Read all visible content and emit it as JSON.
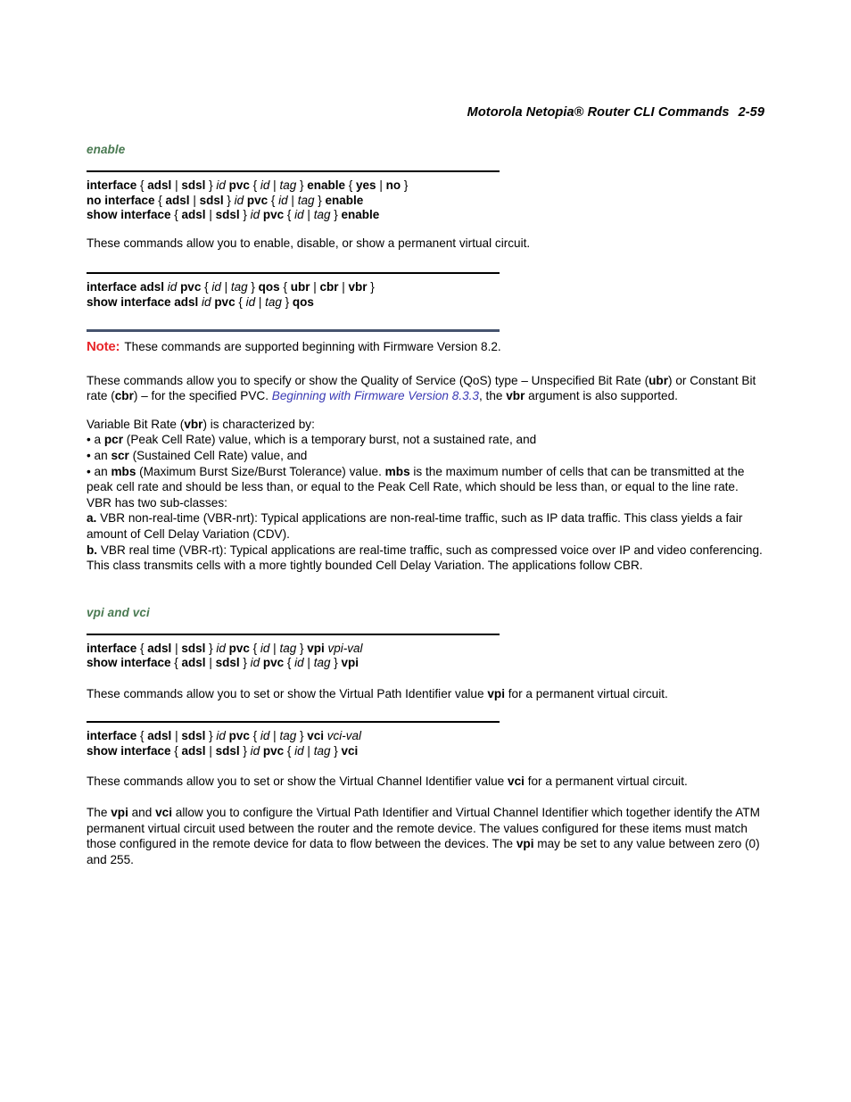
{
  "header": {
    "title": "Motorola Netopia® Router CLI Commands",
    "page_number": "2-59"
  },
  "colors": {
    "section_heading": "#4a7a52",
    "note_label": "#e8262a",
    "note_rule": "#46536e",
    "cross_reference": "#3a3ab4",
    "body_text": "#000000"
  },
  "sections": [
    {
      "id": "enable",
      "heading": "enable",
      "syntax_blocks": [
        {
          "lines": [
            [
              {
                "t": "interface ",
                "s": "b"
              },
              {
                "t": "{ ",
                "s": "n"
              },
              {
                "t": "adsl ",
                "s": "b"
              },
              {
                "t": "| ",
                "s": "n"
              },
              {
                "t": "sdsl ",
                "s": "b"
              },
              {
                "t": "} ",
                "s": "n"
              },
              {
                "t": "id ",
                "s": "i"
              },
              {
                "t": "pvc ",
                "s": "b"
              },
              {
                "t": "{ ",
                "s": "n"
              },
              {
                "t": "id ",
                "s": "i"
              },
              {
                "t": "| ",
                "s": "n"
              },
              {
                "t": "tag ",
                "s": "i"
              },
              {
                "t": "} ",
                "s": "n"
              },
              {
                "t": "enable ",
                "s": "b"
              },
              {
                "t": "{ ",
                "s": "n"
              },
              {
                "t": "yes ",
                "s": "b"
              },
              {
                "t": "| ",
                "s": "n"
              },
              {
                "t": "no ",
                "s": "b"
              },
              {
                "t": "}",
                "s": "n"
              }
            ],
            [
              {
                "t": "no interface ",
                "s": "b"
              },
              {
                "t": "{ ",
                "s": "n"
              },
              {
                "t": "adsl ",
                "s": "b"
              },
              {
                "t": "| ",
                "s": "n"
              },
              {
                "t": "sdsl ",
                "s": "b"
              },
              {
                "t": "} ",
                "s": "n"
              },
              {
                "t": "id ",
                "s": "i"
              },
              {
                "t": "pvc ",
                "s": "b"
              },
              {
                "t": "{ ",
                "s": "n"
              },
              {
                "t": "id ",
                "s": "i"
              },
              {
                "t": "| ",
                "s": "n"
              },
              {
                "t": "tag ",
                "s": "i"
              },
              {
                "t": "} ",
                "s": "n"
              },
              {
                "t": "enable",
                "s": "b"
              }
            ],
            [
              {
                "t": "show interface ",
                "s": "b"
              },
              {
                "t": "{ ",
                "s": "n"
              },
              {
                "t": "adsl ",
                "s": "b"
              },
              {
                "t": "| ",
                "s": "n"
              },
              {
                "t": "sdsl ",
                "s": "b"
              },
              {
                "t": "} ",
                "s": "n"
              },
              {
                "t": "id ",
                "s": "i"
              },
              {
                "t": "pvc ",
                "s": "b"
              },
              {
                "t": "{ ",
                "s": "n"
              },
              {
                "t": "id ",
                "s": "i"
              },
              {
                "t": "| ",
                "s": "n"
              },
              {
                "t": "tag ",
                "s": "i"
              },
              {
                "t": "} ",
                "s": "n"
              },
              {
                "t": "enable",
                "s": "b"
              }
            ]
          ]
        }
      ],
      "paragraph_1": "These commands allow you to enable, disable, or show a permanent virtual circuit."
    }
  ],
  "qos": {
    "syntax_lines": [
      [
        {
          "t": "interface adsl ",
          "s": "b"
        },
        {
          "t": "id ",
          "s": "i"
        },
        {
          "t": "pvc ",
          "s": "b"
        },
        {
          "t": "{ ",
          "s": "n"
        },
        {
          "t": "id ",
          "s": "i"
        },
        {
          "t": "| ",
          "s": "n"
        },
        {
          "t": "tag ",
          "s": "i"
        },
        {
          "t": "} ",
          "s": "n"
        },
        {
          "t": "qos ",
          "s": "b"
        },
        {
          "t": "{ ",
          "s": "n"
        },
        {
          "t": "ubr ",
          "s": "b"
        },
        {
          "t": "| ",
          "s": "n"
        },
        {
          "t": "cbr ",
          "s": "b"
        },
        {
          "t": "| ",
          "s": "n"
        },
        {
          "t": "vbr ",
          "s": "b"
        },
        {
          "t": "}",
          "s": "n"
        }
      ],
      [
        {
          "t": "show interface adsl ",
          "s": "b"
        },
        {
          "t": "id ",
          "s": "i"
        },
        {
          "t": "pvc ",
          "s": "b"
        },
        {
          "t": "{ ",
          "s": "n"
        },
        {
          "t": "id ",
          "s": "i"
        },
        {
          "t": "| ",
          "s": "n"
        },
        {
          "t": "tag ",
          "s": "i"
        },
        {
          "t": "} ",
          "s": "n"
        },
        {
          "t": "qos",
          "s": "b"
        }
      ]
    ],
    "note": {
      "label": "Note:",
      "text": "These commands are supported beginning with Firmware Version 8.2."
    },
    "paragraph_parts": [
      {
        "t": "These commands allow you to specify or show the Quality of Service (QoS) type – Unspecified Bit Rate (",
        "s": "n"
      },
      {
        "t": "ubr",
        "s": "b"
      },
      {
        "t": ") or Constant Bit rate (",
        "s": "n"
      },
      {
        "t": "cbr",
        "s": "b"
      },
      {
        "t": ") – for the specified PVC. ",
        "s": "n"
      },
      {
        "t": "Beginning with Firmware Version 8.3.3",
        "s": "link"
      },
      {
        "t": ", the ",
        "s": "n"
      },
      {
        "t": "vbr",
        "s": "b"
      },
      {
        "t": " argument is also supported.",
        "s": "n"
      }
    ],
    "vbr_block": [
      [
        {
          "t": "Variable Bit Rate (",
          "s": "n"
        },
        {
          "t": "vbr",
          "s": "b"
        },
        {
          "t": ") is characterized by:",
          "s": "n"
        }
      ],
      [
        {
          "t": "• a ",
          "s": "n"
        },
        {
          "t": "pcr",
          "s": "b"
        },
        {
          "t": " (Peak Cell Rate) value, which is a temporary burst, not a sustained rate, and",
          "s": "n"
        }
      ],
      [
        {
          "t": "• an ",
          "s": "n"
        },
        {
          "t": "scr",
          "s": "b"
        },
        {
          "t": " (Sustained Cell Rate) value, and",
          "s": "n"
        }
      ],
      [
        {
          "t": "• an ",
          "s": "n"
        },
        {
          "t": "mbs",
          "s": "b"
        },
        {
          "t": " (Maximum Burst Size/Burst Tolerance) value. ",
          "s": "n"
        },
        {
          "t": "mbs",
          "s": "b"
        },
        {
          "t": " is the maximum number of cells that can be transmitted at the peak cell rate and should be less than, or equal to the Peak Cell Rate, which should be less than, or equal to the line rate.",
          "s": "n"
        }
      ],
      [
        {
          "t": "VBR has two sub-classes:",
          "s": "n"
        }
      ],
      [
        {
          "t": "a.",
          "s": "b"
        },
        {
          "t": " VBR non-real-time (VBR-nrt): Typical applications are non-real-time traffic, such as IP data traffic. This class yields a fair amount of Cell Delay Variation (CDV).",
          "s": "n"
        }
      ],
      [
        {
          "t": "b.",
          "s": "b"
        },
        {
          "t": " VBR real time (VBR-rt): Typical applications are real-time traffic, such as compressed voice over IP and video conferencing. This class transmits cells with a more tightly bounded Cell Delay Variation. The applications follow CBR.",
          "s": "n"
        }
      ]
    ]
  },
  "vpi_vci": {
    "heading": "vpi and vci",
    "vpi_syntax_lines": [
      [
        {
          "t": "interface ",
          "s": "b"
        },
        {
          "t": "{ ",
          "s": "n"
        },
        {
          "t": "adsl ",
          "s": "b"
        },
        {
          "t": "| ",
          "s": "n"
        },
        {
          "t": "sdsl ",
          "s": "b"
        },
        {
          "t": "} ",
          "s": "n"
        },
        {
          "t": "id ",
          "s": "i"
        },
        {
          "t": "pvc ",
          "s": "b"
        },
        {
          "t": "{ ",
          "s": "n"
        },
        {
          "t": "id ",
          "s": "i"
        },
        {
          "t": "| ",
          "s": "n"
        },
        {
          "t": "tag ",
          "s": "i"
        },
        {
          "t": "} ",
          "s": "n"
        },
        {
          "t": "vpi ",
          "s": "b"
        },
        {
          "t": "vpi-val",
          "s": "i"
        }
      ],
      [
        {
          "t": "show interface ",
          "s": "b"
        },
        {
          "t": "{ ",
          "s": "n"
        },
        {
          "t": "adsl ",
          "s": "b"
        },
        {
          "t": "| ",
          "s": "n"
        },
        {
          "t": "sdsl ",
          "s": "b"
        },
        {
          "t": "} ",
          "s": "n"
        },
        {
          "t": "id ",
          "s": "i"
        },
        {
          "t": "pvc ",
          "s": "b"
        },
        {
          "t": "{ ",
          "s": "n"
        },
        {
          "t": "id ",
          "s": "i"
        },
        {
          "t": "| ",
          "s": "n"
        },
        {
          "t": "tag ",
          "s": "i"
        },
        {
          "t": "} ",
          "s": "n"
        },
        {
          "t": "vpi",
          "s": "b"
        }
      ]
    ],
    "vpi_paragraph_parts": [
      {
        "t": "These commands allow you to set or show the Virtual Path Identifier value ",
        "s": "n"
      },
      {
        "t": "vpi",
        "s": "b"
      },
      {
        "t": " for a permanent virtual circuit.",
        "s": "n"
      }
    ],
    "vci_syntax_lines": [
      [
        {
          "t": "interface ",
          "s": "b"
        },
        {
          "t": "{ ",
          "s": "n"
        },
        {
          "t": "adsl ",
          "s": "b"
        },
        {
          "t": "| ",
          "s": "n"
        },
        {
          "t": "sdsl ",
          "s": "b"
        },
        {
          "t": "} ",
          "s": "n"
        },
        {
          "t": "id ",
          "s": "i"
        },
        {
          "t": "pvc ",
          "s": "b"
        },
        {
          "t": "{ ",
          "s": "n"
        },
        {
          "t": "id ",
          "s": "i"
        },
        {
          "t": "| ",
          "s": "n"
        },
        {
          "t": "tag ",
          "s": "i"
        },
        {
          "t": "} ",
          "s": "n"
        },
        {
          "t": "vci ",
          "s": "b"
        },
        {
          "t": "vci-val",
          "s": "i"
        }
      ],
      [
        {
          "t": "show interface ",
          "s": "b"
        },
        {
          "t": "{ ",
          "s": "n"
        },
        {
          "t": "adsl ",
          "s": "b"
        },
        {
          "t": "| ",
          "s": "n"
        },
        {
          "t": "sdsl ",
          "s": "b"
        },
        {
          "t": "} ",
          "s": "n"
        },
        {
          "t": "id ",
          "s": "i"
        },
        {
          "t": "pvc ",
          "s": "b"
        },
        {
          "t": "{ ",
          "s": "n"
        },
        {
          "t": "id ",
          "s": "i"
        },
        {
          "t": "| ",
          "s": "n"
        },
        {
          "t": "tag ",
          "s": "i"
        },
        {
          "t": "} ",
          "s": "n"
        },
        {
          "t": "vci",
          "s": "b"
        }
      ]
    ],
    "vci_paragraph_parts": [
      {
        "t": "These commands allow you to set or show the Virtual Channel Identifier value ",
        "s": "n"
      },
      {
        "t": "vci",
        "s": "b"
      },
      {
        "t": " for a permanent virtual circuit.",
        "s": "n"
      }
    ],
    "summary_paragraph_parts": [
      {
        "t": "The ",
        "s": "n"
      },
      {
        "t": "vpi",
        "s": "b"
      },
      {
        "t": " and ",
        "s": "n"
      },
      {
        "t": "vci",
        "s": "b"
      },
      {
        "t": " allow you to configure the Virtual Path Identifier and Virtual Channel Identifier which together identify the ATM permanent virtual circuit used between the router and the remote device. The values configured for these items must match those configured in the remote device for data to flow between the devices. The ",
        "s": "n"
      },
      {
        "t": "vpi",
        "s": "b"
      },
      {
        "t": " may be set to any value between zero (0) and 255.",
        "s": "n"
      }
    ]
  }
}
